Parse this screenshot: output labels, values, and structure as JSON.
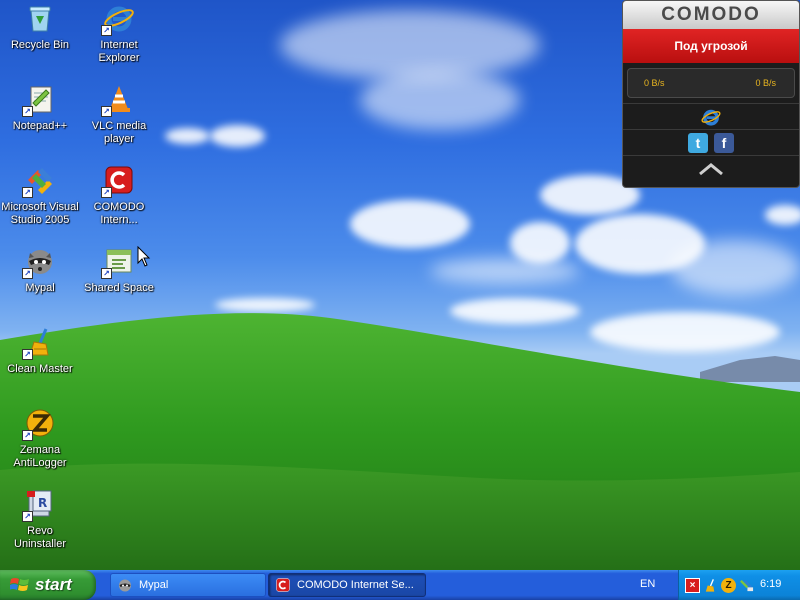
{
  "desktop": {
    "icons": [
      {
        "label": "Recycle Bin",
        "icon": "recycle-bin-icon",
        "shortcut": false
      },
      {
        "label": "Internet Explorer",
        "icon": "internet-explorer-icon",
        "shortcut": true
      },
      {
        "label": "Notepad++",
        "icon": "notepad-plus-plus-icon",
        "shortcut": true
      },
      {
        "label": "VLC media player",
        "icon": "vlc-cone-icon",
        "shortcut": true
      },
      {
        "label": "Microsoft Visual Studio 2005",
        "icon": "visual-studio-icon",
        "shortcut": true
      },
      {
        "label": "COMODO Intern...",
        "icon": "comodo-icon",
        "shortcut": true
      },
      {
        "label": "Mypal",
        "icon": "mypal-raccoon-icon",
        "shortcut": true
      },
      {
        "label": "Shared Space",
        "icon": "shared-space-icon",
        "shortcut": true
      },
      {
        "label": "Clean Master",
        "icon": "broom-icon",
        "shortcut": true
      },
      {
        "label": "Zemana AntiLogger",
        "icon": "zemana-icon",
        "shortcut": true
      },
      {
        "label": "Revo Uninstaller",
        "icon": "revo-uninstaller-icon",
        "shortcut": true
      }
    ]
  },
  "comodo_widget": {
    "brand": "COMODO",
    "status": "Под угрозой",
    "download_rate": "0 B/s",
    "upload_rate": "0 B/s",
    "status_color": "#d81b1b",
    "rate_color": "#e8b520"
  },
  "taskbar": {
    "start_label": "start",
    "buttons": [
      {
        "label": "Mypal",
        "icon": "mypal-raccoon-icon",
        "active": false
      },
      {
        "label": "COMODO Internet Se...",
        "icon": "comodo-icon",
        "active": true
      }
    ],
    "language": "EN",
    "clock": "6:19",
    "tray_icons": [
      "comodo-tray-icon",
      "broom-tray-icon",
      "zemana-tray-icon",
      "network-tray-icon"
    ]
  }
}
